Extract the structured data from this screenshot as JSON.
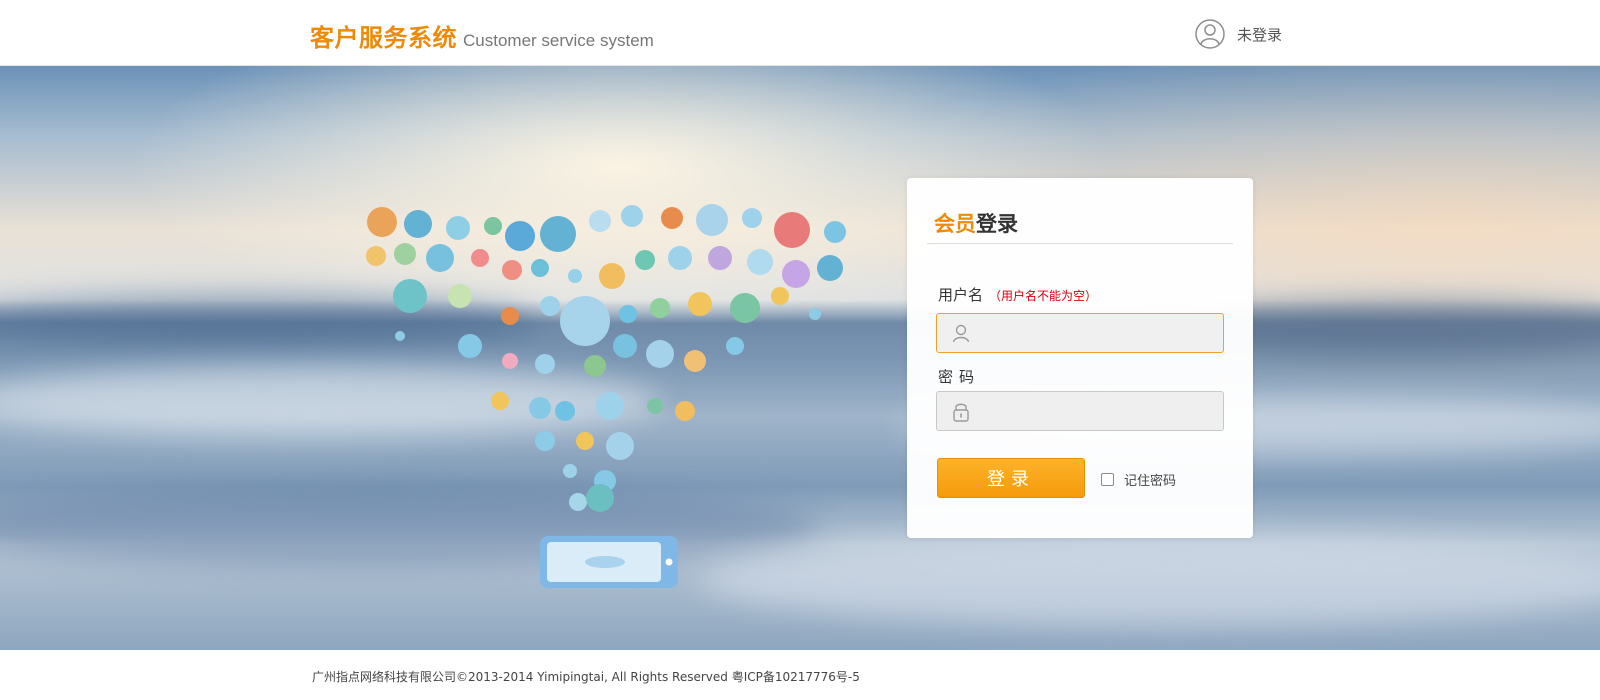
{
  "header": {
    "brand_cn": "客户服务系统",
    "brand_en": "Customer service system",
    "user_status": "未登录"
  },
  "login": {
    "title_highlight": "会员",
    "title_rest": "登录",
    "username_label": "用户名",
    "username_error": "（用户名不能为空）",
    "username_value": "",
    "password_label": "密码",
    "password_value": "",
    "submit_label": "登录",
    "remember_label": "记住密码",
    "remember_checked": false
  },
  "footer": {
    "copyright": "广州指点网络科技有限公司©2013-2014 Yimipingtai, All Rights Reserved 粤ICP备10217776号-5"
  },
  "colors": {
    "accent": "#ee8a0a",
    "button": "#f59a0b",
    "error": "#d6000f"
  },
  "icons": [
    "user-circle-icon",
    "user-icon",
    "lock-icon",
    "apps-cloud-illustration",
    "tablet-illustration"
  ]
}
